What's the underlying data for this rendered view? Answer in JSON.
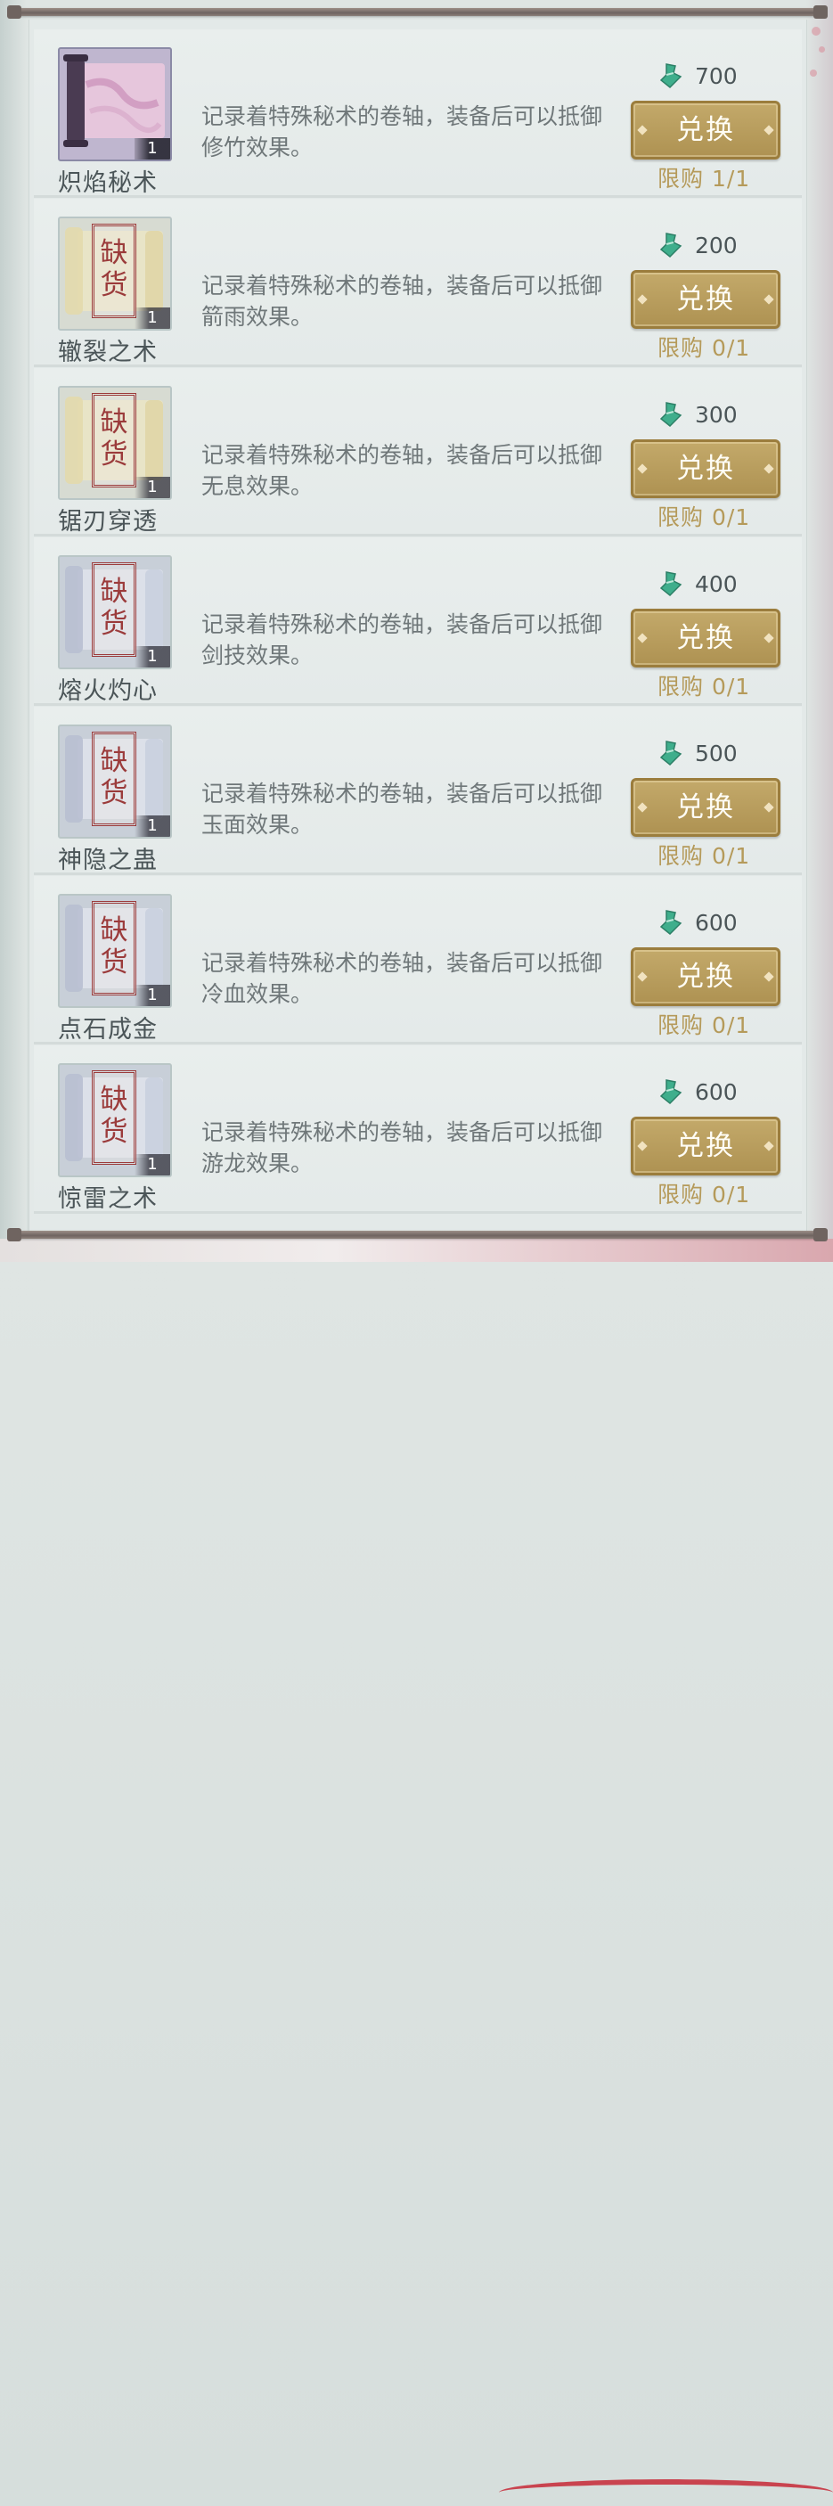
{
  "theme": {
    "button_color": "#b69a5a",
    "limit_color": "#b59a5a",
    "stamp_color": "#9b3b3b",
    "currency_color": "#3fae8c"
  },
  "items": [
    {
      "name": "炽焰秘术",
      "description": "记录着特殊秘术的卷轴，装备后可以抵御修竹效果。",
      "price": "700",
      "button": "兑换",
      "limit": "限购 1/1",
      "quantity": "1",
      "stamp": "",
      "stamp_char1": "",
      "stamp_char2": "",
      "icon": "pink-scroll-icon"
    },
    {
      "name": "辙裂之术",
      "description": "记录着特殊秘术的卷轴，装备后可以抵御箭雨效果。",
      "price": "200",
      "button": "兑换",
      "limit": "限购 0/1",
      "quantity": "1",
      "stamp_char1": "缺",
      "stamp_char2": "货",
      "icon": "gold-scroll-icon"
    },
    {
      "name": "锯刃穿透",
      "description": "记录着特殊秘术的卷轴，装备后可以抵御无息效果。",
      "price": "300",
      "button": "兑换",
      "limit": "限购 0/1",
      "quantity": "1",
      "stamp_char1": "缺",
      "stamp_char2": "货",
      "icon": "gold-scroll-icon"
    },
    {
      "name": "熔火灼心",
      "description": "记录着特殊秘术的卷轴，装备后可以抵御剑技效果。",
      "price": "400",
      "button": "兑换",
      "limit": "限购 0/1",
      "quantity": "1",
      "stamp_char1": "缺",
      "stamp_char2": "货",
      "icon": "silver-scroll-icon"
    },
    {
      "name": "神隐之蛊",
      "description": "记录着特殊秘术的卷轴，装备后可以抵御玉面效果。",
      "price": "500",
      "button": "兑换",
      "limit": "限购 0/1",
      "quantity": "1",
      "stamp_char1": "缺",
      "stamp_char2": "货",
      "icon": "silver-scroll-icon"
    },
    {
      "name": "点石成金",
      "description": "记录着特殊秘术的卷轴，装备后可以抵御冷血效果。",
      "price": "600",
      "button": "兑换",
      "limit": "限购 0/1",
      "quantity": "1",
      "stamp_char1": "缺",
      "stamp_char2": "货",
      "icon": "silver-scroll-icon"
    },
    {
      "name": "惊雷之术",
      "description": "记录着特殊秘术的卷轴，装备后可以抵御游龙效果。",
      "price": "600",
      "button": "兑换",
      "limit": "限购 0/1",
      "quantity": "1",
      "stamp_char1": "缺",
      "stamp_char2": "货",
      "icon": "silver-scroll-icon"
    }
  ]
}
